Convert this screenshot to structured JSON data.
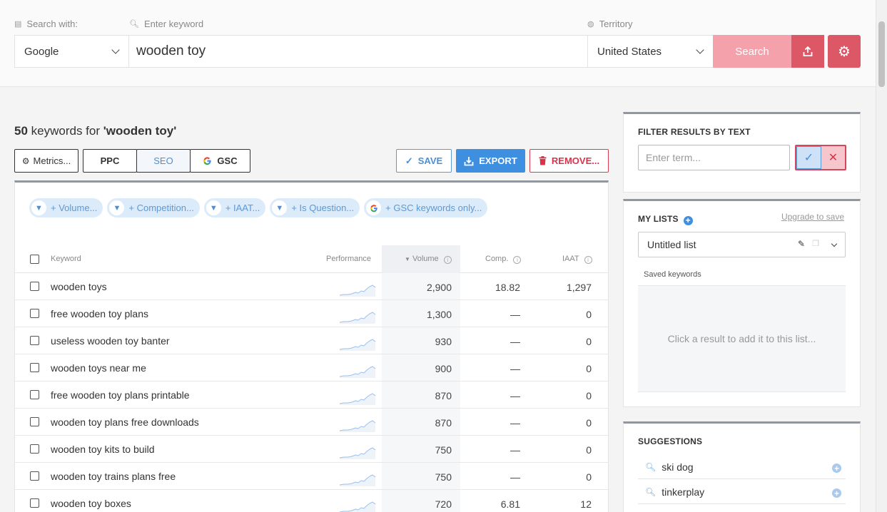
{
  "search": {
    "search_with_label": "Search with:",
    "keyword_label": "Enter keyword",
    "territory_label": "Territory",
    "engine": "Google",
    "keyword": "wooden toy",
    "territory": "United States",
    "search_button": "Search"
  },
  "results": {
    "count": "50",
    "title_mid": " keywords for ",
    "query": "'wooden toy'",
    "metrics_button": "Metrics...",
    "tab_ppc": "PPC",
    "tab_seo": "SEO",
    "tab_gsc": "GSC",
    "save": "SAVE",
    "export": "EXPORT",
    "remove": "REMOVE..."
  },
  "filters": [
    "+ Volume...",
    "+ Competition...",
    "+ IAAT...",
    "+ Is Question...",
    "+ GSC keywords only..."
  ],
  "table": {
    "headers": {
      "keyword": "Keyword",
      "performance": "Performance",
      "volume": "Volume",
      "comp": "Comp.",
      "iaat": "IAAT"
    },
    "rows": [
      {
        "keyword": "wooden toys",
        "volume": "2,900",
        "comp": "18.82",
        "iaat": "1,297"
      },
      {
        "keyword": "free wooden toy plans",
        "volume": "1,300",
        "comp": "—",
        "iaat": "0"
      },
      {
        "keyword": "useless wooden toy banter",
        "volume": "930",
        "comp": "—",
        "iaat": "0"
      },
      {
        "keyword": "wooden toys near me",
        "volume": "900",
        "comp": "—",
        "iaat": "0"
      },
      {
        "keyword": "free wooden toy plans printable",
        "volume": "870",
        "comp": "—",
        "iaat": "0"
      },
      {
        "keyword": "wooden toy plans free downloads",
        "volume": "870",
        "comp": "—",
        "iaat": "0"
      },
      {
        "keyword": "wooden toy kits to build",
        "volume": "750",
        "comp": "—",
        "iaat": "0"
      },
      {
        "keyword": "wooden toy trains plans free",
        "volume": "750",
        "comp": "—",
        "iaat": "0"
      },
      {
        "keyword": "wooden toy boxes",
        "volume": "720",
        "comp": "6.81",
        "iaat": "12"
      }
    ]
  },
  "sidebar": {
    "filter_title": "FILTER RESULTS BY TEXT",
    "filter_placeholder": "Enter term...",
    "lists_title": "MY LISTS",
    "upgrade": "Upgrade to save",
    "list_name": "Untitled list",
    "saved_label": "Saved keywords",
    "saved_empty": "Click a result to add it to this list...",
    "suggestions_title": "SUGGESTIONS",
    "suggestions": [
      "ski dog",
      "tinkerplay"
    ]
  },
  "colors": {
    "accent_blue": "#3f8fe0",
    "accent_red": "#dc5867",
    "search_pink": "#f4a1ab"
  }
}
